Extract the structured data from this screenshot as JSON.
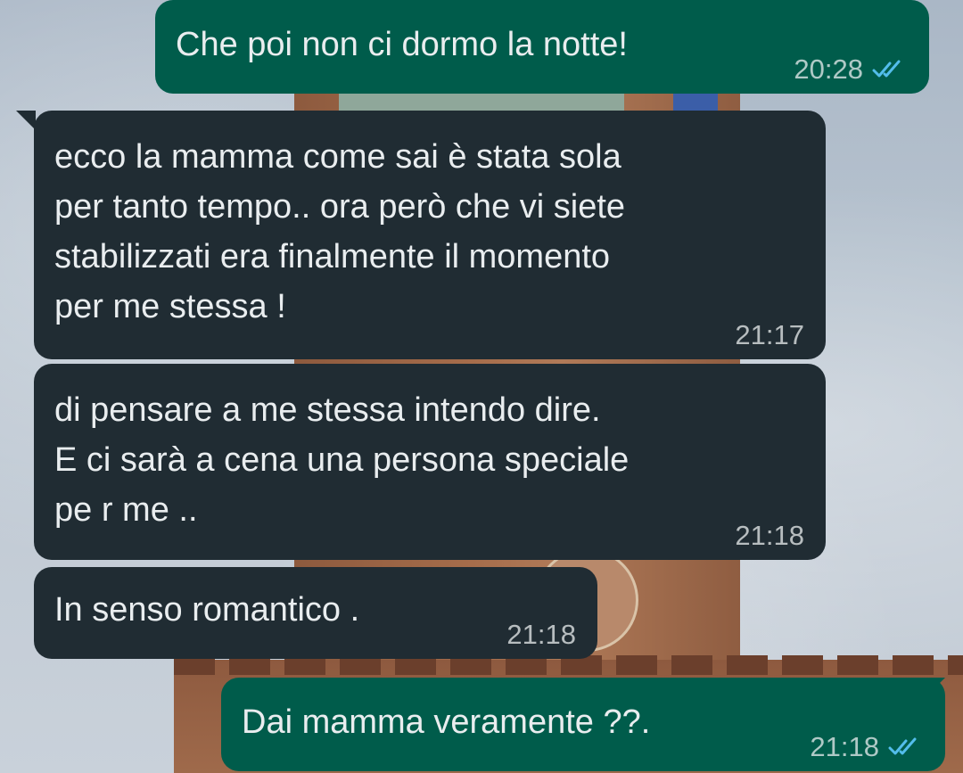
{
  "background": {
    "description_icon": "photo-background-icon"
  },
  "colors": {
    "outgoing_bubble": "#005c4b",
    "incoming_bubble": "#202c33",
    "text": "#e9edef",
    "read_ticks": "#53bdeb"
  },
  "messages": [
    {
      "id": "m1",
      "direction": "outgoing",
      "text": "Che poi non ci dormo la notte!",
      "time": "20:28",
      "status": "read"
    },
    {
      "id": "m2",
      "direction": "incoming",
      "text": "ecco la mamma come sai è stata sola\nper tanto tempo.. ora però che vi siete\nstabilizzati era finalmente il momento\nper me stessa !",
      "time": "21:17"
    },
    {
      "id": "m3",
      "direction": "incoming",
      "text": "di pensare a me stessa intendo dire.\nE ci sarà a cena una persona speciale\npe r me ..",
      "time": "21:18"
    },
    {
      "id": "m4",
      "direction": "incoming",
      "text": "In senso romantico .",
      "time": "21:18"
    },
    {
      "id": "m5",
      "direction": "outgoing",
      "text": "Dai mamma veramente ??.",
      "time": "21:18",
      "status": "read"
    }
  ]
}
